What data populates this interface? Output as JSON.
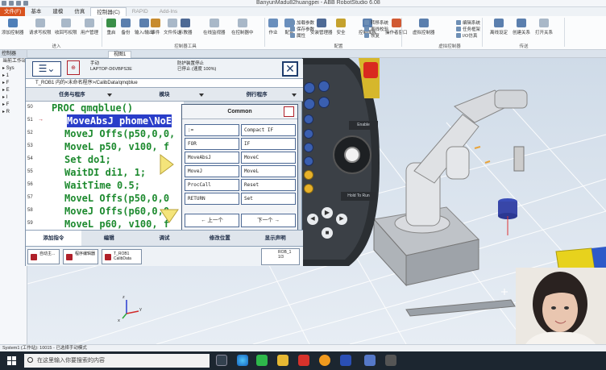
{
  "window": {
    "title": "BanyunMadu82huangpei - ABB RobotStudio 6.08"
  },
  "ribbon_tabs": [
    {
      "label": "文件(F)",
      "kind": "file"
    },
    {
      "label": "基本",
      "kind": ""
    },
    {
      "label": "建模",
      "kind": ""
    },
    {
      "label": "仿真",
      "kind": ""
    },
    {
      "label": "控制器(C)",
      "kind": "active"
    },
    {
      "label": "RAPID",
      "kind": "dim"
    },
    {
      "label": "Add-Ins",
      "kind": "dim"
    }
  ],
  "ribbon_buttons": [
    {
      "label": "添加控制器",
      "color": "#4f7fb8"
    },
    {
      "label": "请求写权限",
      "color": "#a9b8c8"
    },
    {
      "label": "收回写权限",
      "color": "#a9b8c8"
    },
    {
      "label": "用户管理",
      "color": "#a9b8c8"
    },
    {
      "label": "重启",
      "color": "#3a8f48"
    },
    {
      "label": "备份",
      "color": "#5b7fae"
    },
    {
      "label": "输入/输出",
      "color": "#5b7fae"
    },
    {
      "label": "事件",
      "color": "#c78b2e"
    },
    {
      "label": "文件传送",
      "color": "#a9b8c8"
    },
    {
      "label": "示教器",
      "color": "#4e6a95"
    },
    {
      "label": "在线监视器",
      "color": "#a9b8c8"
    },
    {
      "label": "在控制器中",
      "color": "#a9b8c8"
    },
    {
      "label": "作业",
      "color": "#6a8fbd"
    },
    {
      "label": "配置",
      "color": "#6a8fbd"
    },
    {
      "label": "安装管理器",
      "color": "#4e6a95"
    },
    {
      "label": "安全",
      "color": "#c5a22e"
    },
    {
      "label": "控制面板",
      "color": "#5b7fae"
    },
    {
      "label": "操作者窗口",
      "color": "#d15a33"
    },
    {
      "label": "虚拟控制器",
      "color": "#5b7fae"
    },
    {
      "label": "离线设定",
      "color": "#5b7fae"
    },
    {
      "label": "创建关系",
      "color": "#5b7fae"
    },
    {
      "label": "打开关系",
      "color": "#a9b8c8"
    }
  ],
  "ribbon_small": {
    "add_param": "加载参数",
    "save_param": "保存参数",
    "properties": "属性",
    "transfer_sys": "转移系统",
    "online": "离线校验",
    "restore": "恢复",
    "robot_log": "编辑系统",
    "task_frame": "任务框架",
    "io_sim": "I/O仿真"
  },
  "ribbon_groups": [
    "进入",
    "控制器工具",
    "配置",
    "虚拟控制器",
    "传送"
  ],
  "left_panel": {
    "header": "控制器",
    "rows": [
      "当前工作站",
      "▸ Sys",
      "  ▸ 1",
      "  ▸ F",
      "  ▸ E",
      "  ▸ I",
      "  ▸ F",
      "  ▸ R"
    ]
  },
  "doc_tab": {
    "label": "视图1"
  },
  "flexpendant": {
    "info": {
      "line1": "手动",
      "line2": "LAPTOP-D6VBPS3E"
    },
    "status": {
      "line1": "防护装置停止",
      "line2": "已停止 (速度 100%)"
    },
    "path": "T_ROB1 内的<未命名程序>/CalibData/qmqblue",
    "menus": [
      "任务与程序",
      "模块",
      "例行程序"
    ],
    "code_lines": [
      {
        "n": "50",
        "text": "PROC qmqblue()",
        "indent": 32,
        "sel": false,
        "arrow": false
      },
      {
        "n": "51",
        "text": "MoveAbsJ phome\\NoE",
        "indent": 51,
        "sel": true,
        "arrow": true
      },
      {
        "n": "52",
        "text": "MoveJ Offs(p50,0,0,",
        "indent": 48,
        "sel": false,
        "arrow": false
      },
      {
        "n": "53",
        "text": "MoveL p50, v100, f",
        "indent": 48,
        "sel": false,
        "arrow": false
      },
      {
        "n": "54",
        "text": "Set do1;",
        "indent": 48,
        "sel": false,
        "arrow": false
      },
      {
        "n": "55",
        "text": "WaitDI di1, 1;",
        "indent": 48,
        "sel": false,
        "arrow": false
      },
      {
        "n": "56",
        "text": "WaitTime 0.5;",
        "indent": 48,
        "sel": false,
        "arrow": false
      },
      {
        "n": "57",
        "text": "MoveL Offs(p50,0,0",
        "indent": 48,
        "sel": false,
        "arrow": false
      },
      {
        "n": "58",
        "text": "MoveJ Offs(p60,0,0",
        "indent": 48,
        "sel": false,
        "arrow": false
      },
      {
        "n": "59",
        "text": "MoveL p60, v100, f",
        "indent": 48,
        "sel": false,
        "arrow": false
      }
    ],
    "common": {
      "title": "Common",
      "items": [
        ":=",
        "Compact IF",
        "FOR",
        "IF",
        "MoveAbsJ",
        "MoveC",
        "MoveJ",
        "MoveL",
        "ProcCall",
        "Reset",
        "RETURN",
        "Set"
      ],
      "prev": "← 上一个",
      "next": "下一个 →"
    },
    "bottom_tabs": [
      "添加指令",
      "编辑",
      "调试",
      "修改位置",
      "显示声明"
    ],
    "tasks": [
      {
        "label": "自动主..."
      },
      {
        "label": "程序编辑器"
      },
      {
        "label": "T_ROB1\nCalibData"
      }
    ],
    "rob": "ROB_1",
    "rob_speed": "1/3"
  },
  "jog": {
    "enable": "Enable",
    "hold": "Hold To Run"
  },
  "status": {
    "text": "System1 (工作站): 10015 - 已选择手动模式"
  },
  "taskbar": {
    "search_placeholder": "在这里输入你要搜索的内容"
  },
  "colors": {
    "accent": "#d9531e",
    "code_green": "#1d8a2f",
    "selection_blue": "#2a3ec9",
    "robot_orange": "#e8a33b"
  }
}
